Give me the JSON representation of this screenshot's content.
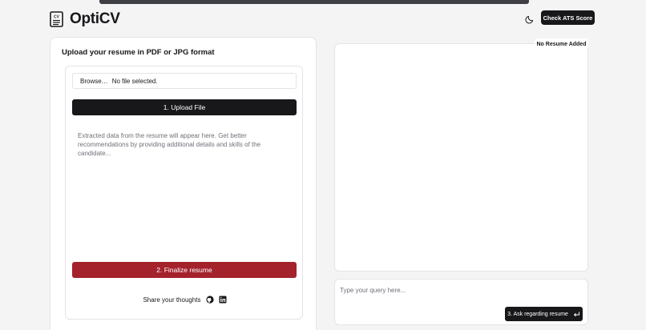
{
  "app": {
    "name": "OptiCV"
  },
  "header": {
    "check_ats_label": "Check ATS Score"
  },
  "upload_card": {
    "title": "Upload your resume in PDF or JPG format",
    "file_browse_label": "Browse…",
    "file_status": "No file selected.",
    "upload_button": "1. Upload File",
    "extracted_placeholder": "Extracted data from the resume will appear here. Get better recommendations by providing additional details and skills of the candidate...",
    "finalize_button": "2. Finalize resume",
    "share_label": "Share your thoughts"
  },
  "preview": {
    "badge": "No Resume Added"
  },
  "query": {
    "placeholder": "Type your query here...",
    "ask_button": "3. Ask regarding resume"
  },
  "icons": {
    "logo": "resume-document-icon",
    "theme": "moon-icon",
    "github": "github-icon",
    "linkedin": "linkedin-icon",
    "enter": "enter-return-icon"
  },
  "colors": {
    "primary": "#18181b",
    "finalize": "#a4222c",
    "background": "#f4f4f5"
  }
}
